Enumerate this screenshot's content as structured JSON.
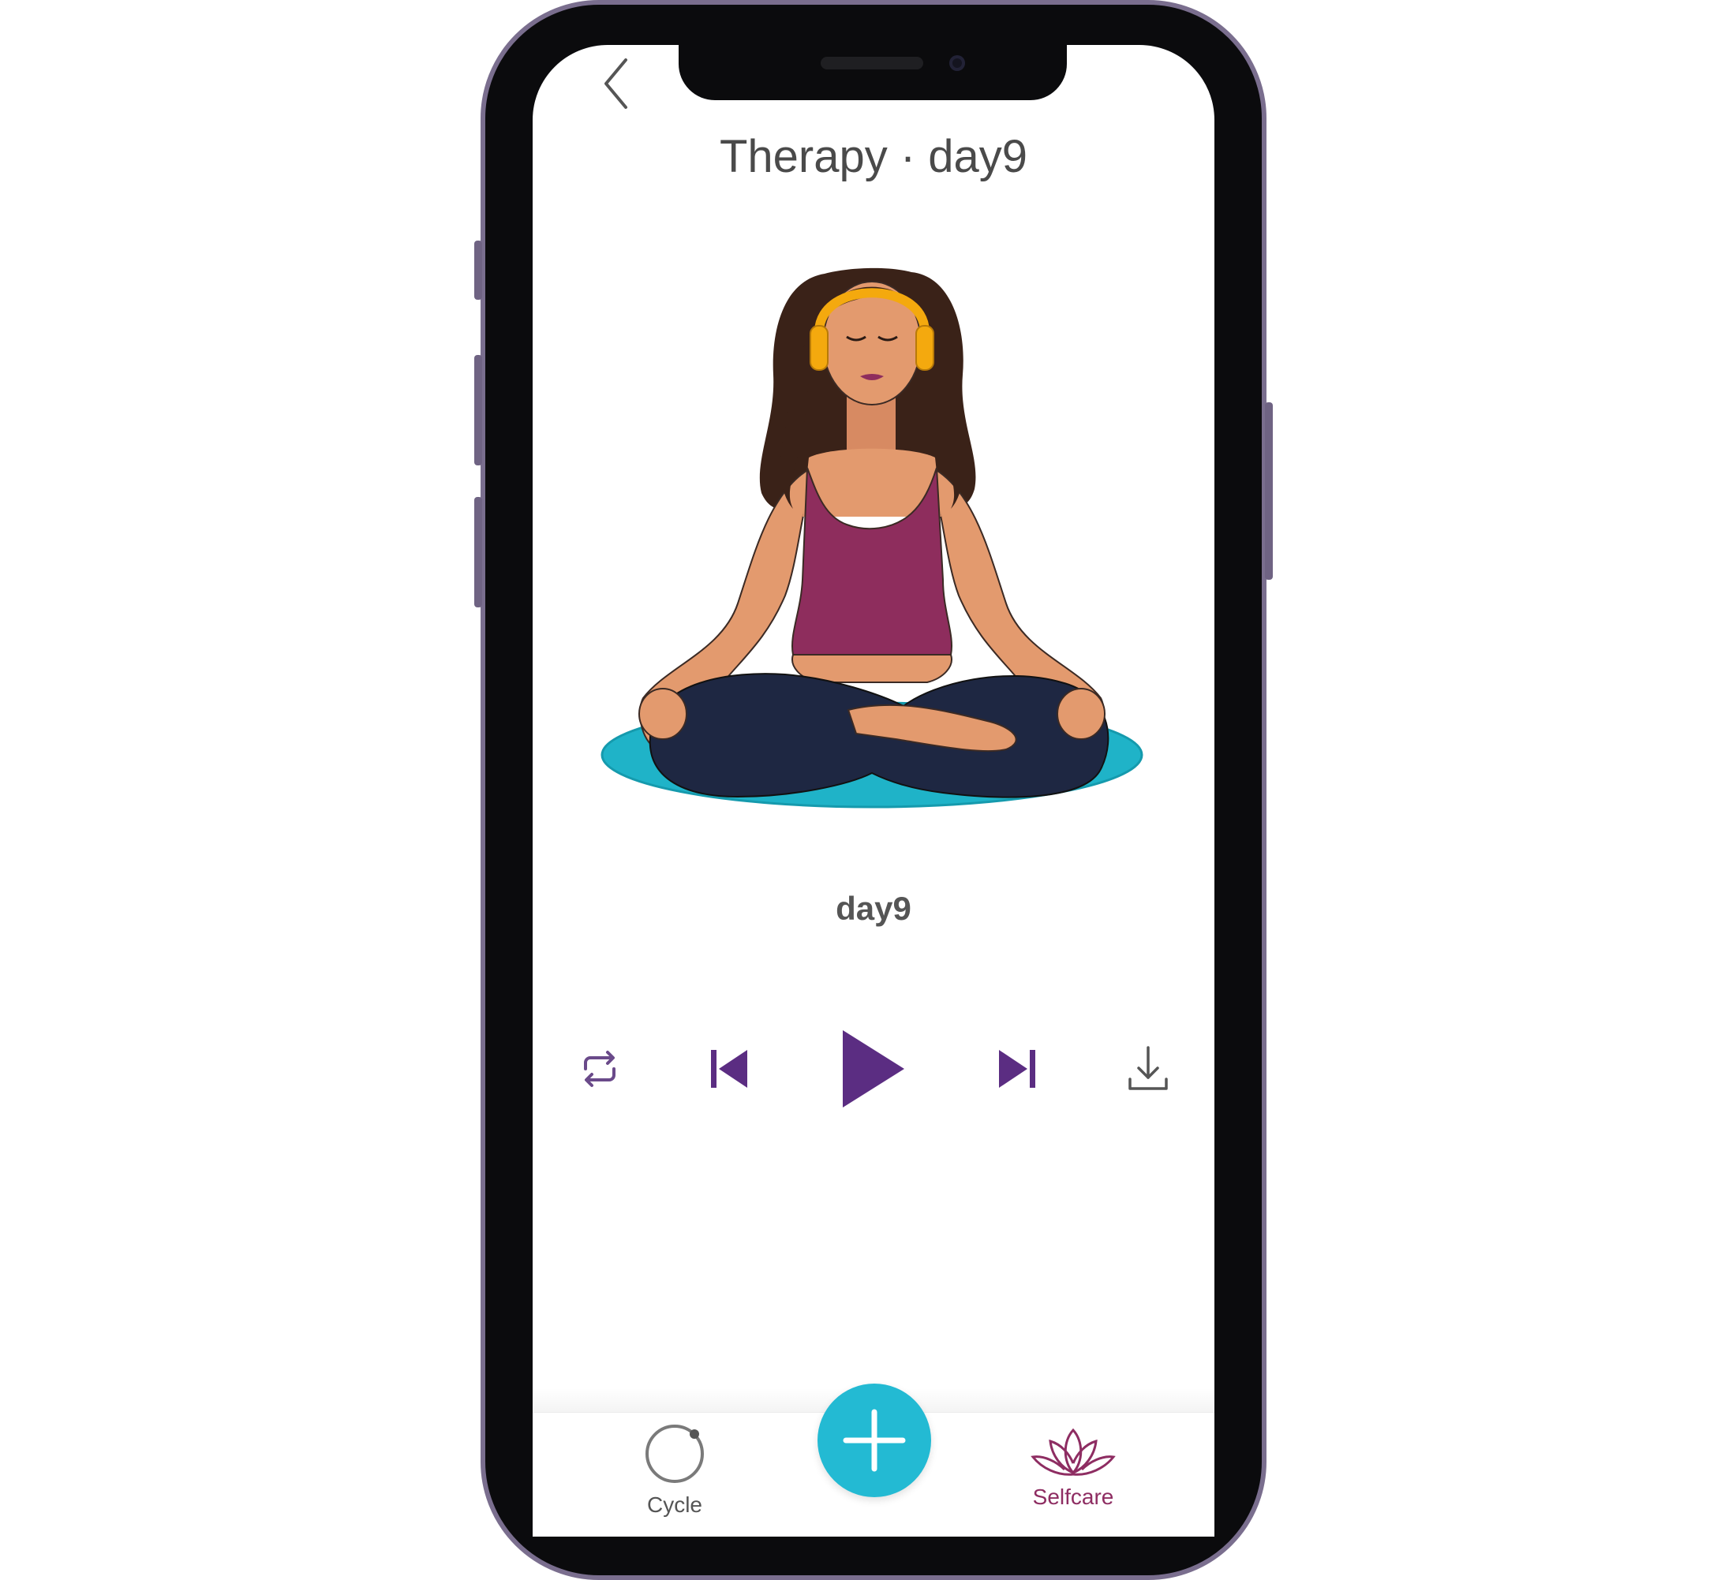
{
  "header": {
    "back_icon": "chevron-left-icon",
    "title": "Therapy · day9"
  },
  "player": {
    "track_title": "day9",
    "controls": {
      "repeat_icon": "repeat-icon",
      "previous_icon": "skip-previous-icon",
      "play_icon": "play-icon",
      "next_icon": "skip-next-icon",
      "download_icon": "download-icon"
    }
  },
  "bottom_nav": {
    "items": [
      {
        "label": "Cycle",
        "icon": "cycle-ring-icon"
      },
      {
        "label": "Selfcare",
        "icon": "lotus-icon"
      }
    ],
    "fab_icon": "plus-icon"
  },
  "colors": {
    "accent_purple": "#5b2d82",
    "selfcare_active": "#8e2d62",
    "fab": "#23bad3",
    "title_text": "#4a4a4a",
    "tank_top": "#8e2d5d",
    "yoga_mat": "#1fb3c8",
    "headphones": "#f4a90e"
  }
}
